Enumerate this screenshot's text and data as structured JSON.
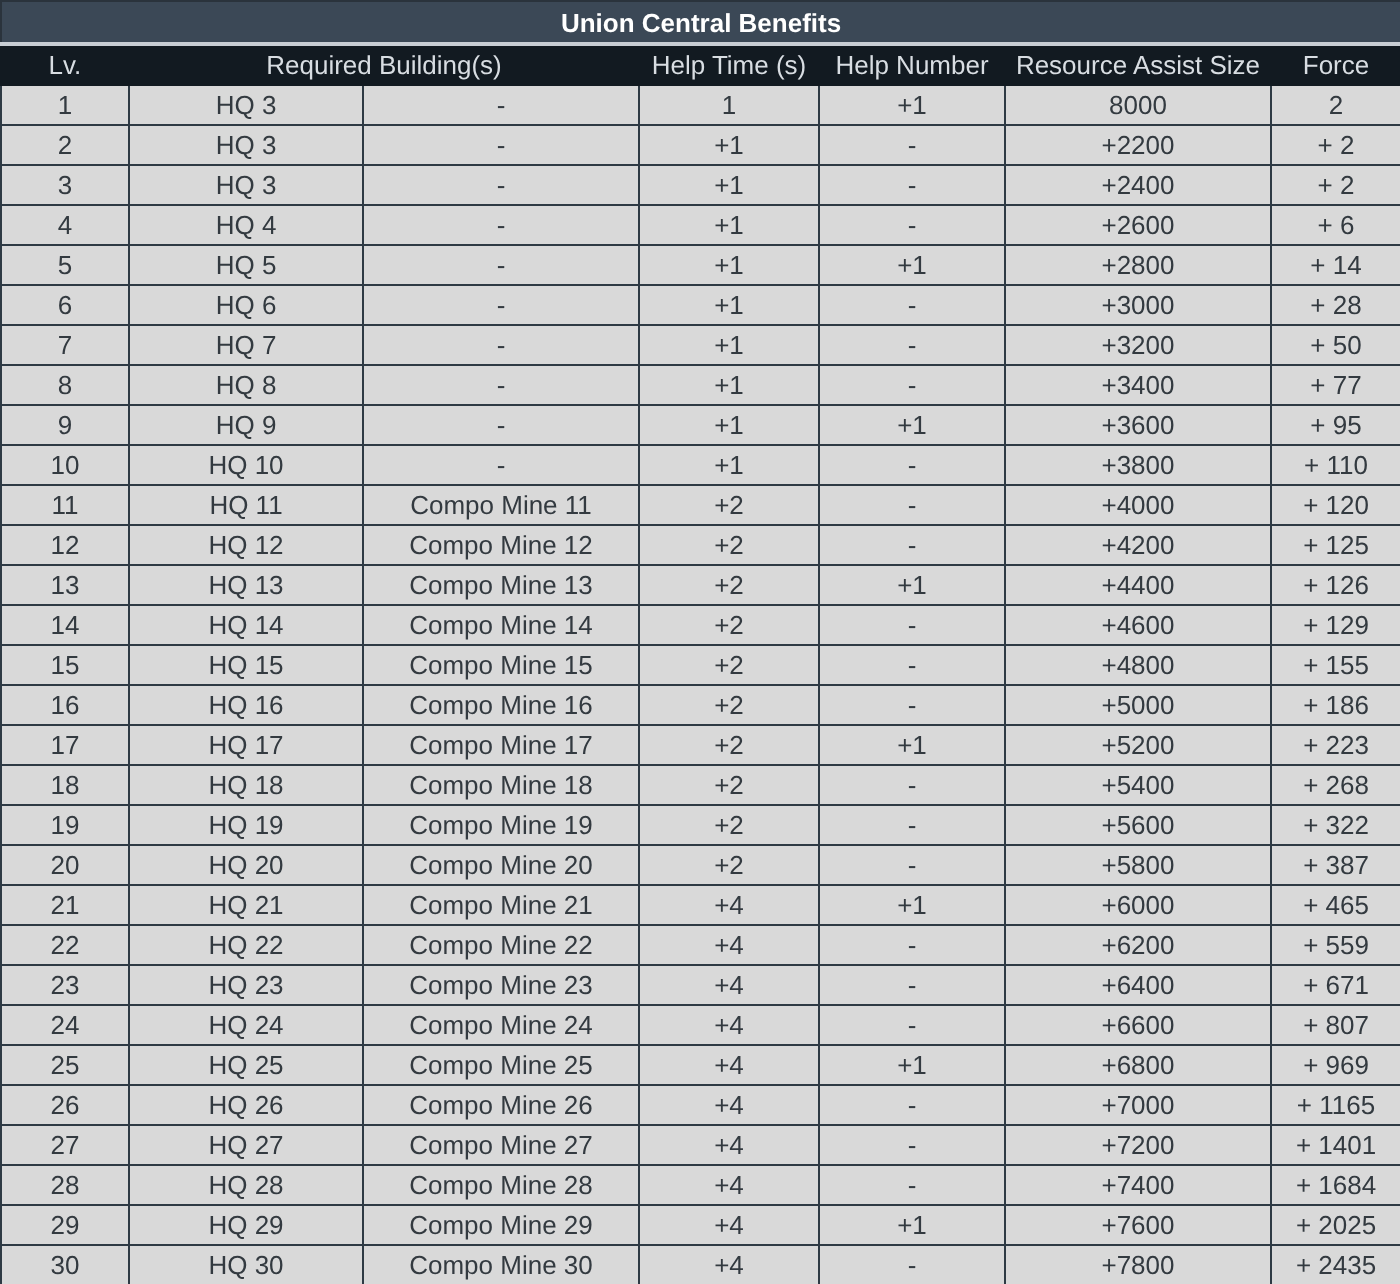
{
  "table": {
    "title": "Union Central Benefits",
    "columns": [
      "Lv.",
      "Required Building(s)",
      "Help Time (s)",
      "Help Number",
      "Resource Assist Size",
      "Force"
    ],
    "rows": [
      [
        "1",
        [
          "HQ 3",
          "-"
        ],
        "1",
        "+1",
        "8000",
        "2"
      ],
      [
        "2",
        [
          "HQ 3",
          "-"
        ],
        "+1",
        "-",
        "+2200",
        "+ 2"
      ],
      [
        "3",
        [
          "HQ 3",
          "-"
        ],
        "+1",
        "-",
        "+2400",
        "+ 2"
      ],
      [
        "4",
        [
          "HQ 4",
          "-"
        ],
        "+1",
        "-",
        "+2600",
        "+ 6"
      ],
      [
        "5",
        [
          "HQ 5",
          "-"
        ],
        "+1",
        "+1",
        "+2800",
        "+ 14"
      ],
      [
        "6",
        [
          "HQ 6",
          "-"
        ],
        "+1",
        "-",
        "+3000",
        "+ 28"
      ],
      [
        "7",
        [
          "HQ 7",
          "-"
        ],
        "+1",
        "-",
        "+3200",
        "+ 50"
      ],
      [
        "8",
        [
          "HQ 8",
          "-"
        ],
        "+1",
        "-",
        "+3400",
        "+ 77"
      ],
      [
        "9",
        [
          "HQ 9",
          "-"
        ],
        "+1",
        "+1",
        "+3600",
        "+ 95"
      ],
      [
        "10",
        [
          "HQ 10",
          "-"
        ],
        "+1",
        "-",
        "+3800",
        "+ 110"
      ],
      [
        "11",
        [
          "HQ 11",
          "Compo Mine 11"
        ],
        "+2",
        "-",
        "+4000",
        "+ 120"
      ],
      [
        "12",
        [
          "HQ 12",
          "Compo Mine 12"
        ],
        "+2",
        "-",
        "+4200",
        "+ 125"
      ],
      [
        "13",
        [
          "HQ 13",
          "Compo Mine 13"
        ],
        "+2",
        "+1",
        "+4400",
        "+ 126"
      ],
      [
        "14",
        [
          "HQ 14",
          "Compo Mine 14"
        ],
        "+2",
        "-",
        "+4600",
        "+ 129"
      ],
      [
        "15",
        [
          "HQ 15",
          "Compo Mine 15"
        ],
        "+2",
        "-",
        "+4800",
        "+ 155"
      ],
      [
        "16",
        [
          "HQ 16",
          "Compo Mine 16"
        ],
        "+2",
        "-",
        "+5000",
        "+ 186"
      ],
      [
        "17",
        [
          "HQ 17",
          "Compo Mine 17"
        ],
        "+2",
        "+1",
        "+5200",
        "+ 223"
      ],
      [
        "18",
        [
          "HQ 18",
          "Compo Mine 18"
        ],
        "+2",
        "-",
        "+5400",
        "+ 268"
      ],
      [
        "19",
        [
          "HQ 19",
          "Compo Mine 19"
        ],
        "+2",
        "-",
        "+5600",
        "+ 322"
      ],
      [
        "20",
        [
          "HQ 20",
          "Compo Mine 20"
        ],
        "+2",
        "-",
        "+5800",
        "+ 387"
      ],
      [
        "21",
        [
          "HQ 21",
          "Compo Mine 21"
        ],
        "+4",
        "+1",
        "+6000",
        "+ 465"
      ],
      [
        "22",
        [
          "HQ 22",
          "Compo Mine 22"
        ],
        "+4",
        "-",
        "+6200",
        "+ 559"
      ],
      [
        "23",
        [
          "HQ 23",
          "Compo Mine 23"
        ],
        "+4",
        "-",
        "+6400",
        "+ 671"
      ],
      [
        "24",
        [
          "HQ 24",
          "Compo Mine 24"
        ],
        "+4",
        "-",
        "+6600",
        "+ 807"
      ],
      [
        "25",
        [
          "HQ 25",
          "Compo Mine 25"
        ],
        "+4",
        "+1",
        "+6800",
        "+ 969"
      ],
      [
        "26",
        [
          "HQ 26",
          "Compo Mine 26"
        ],
        "+4",
        "-",
        "+7000",
        "+ 1165"
      ],
      [
        "27",
        [
          "HQ 27",
          "Compo Mine 27"
        ],
        "+4",
        "-",
        "+7200",
        "+ 1401"
      ],
      [
        "28",
        [
          "HQ 28",
          "Compo Mine 28"
        ],
        "+4",
        "-",
        "+7400",
        "+ 1684"
      ],
      [
        "29",
        [
          "HQ 29",
          "Compo Mine 29"
        ],
        "+4",
        "+1",
        "+7600",
        "+ 2025"
      ],
      [
        "30",
        [
          "HQ 30",
          "Compo Mine 30"
        ],
        "+4",
        "-",
        "+7800",
        "+ 2435"
      ]
    ]
  }
}
